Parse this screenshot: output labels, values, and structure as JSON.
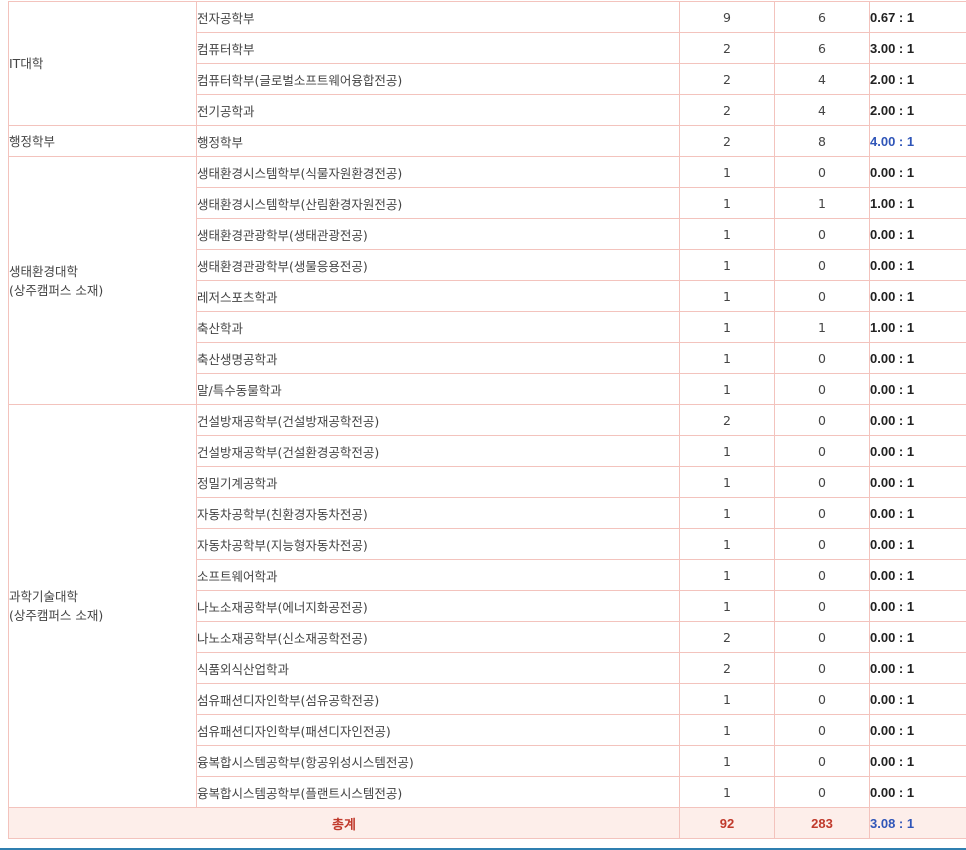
{
  "table": {
    "groups": [
      {
        "college_lines": [
          "IT대학"
        ],
        "rows": [
          {
            "dept": "전자공학부",
            "a": "9",
            "b": "6",
            "ratio": "0.67 : 1"
          },
          {
            "dept": "컴퓨터학부",
            "a": "2",
            "b": "6",
            "ratio": "3.00 : 1"
          },
          {
            "dept": "컴퓨터학부(글로벌소프트웨어융합전공)",
            "a": "2",
            "b": "4",
            "ratio": "2.00 : 1"
          },
          {
            "dept": "전기공학과",
            "a": "2",
            "b": "4",
            "ratio": "2.00 : 1"
          }
        ]
      },
      {
        "college_lines": [
          "행정학부"
        ],
        "rows": [
          {
            "dept": "행정학부",
            "a": "2",
            "b": "8",
            "ratio": "4.00 : 1",
            "highlight": true
          }
        ]
      },
      {
        "college_lines": [
          "생태환경대학",
          "(상주캠퍼스 소재)"
        ],
        "rows": [
          {
            "dept": "생태환경시스템학부(식물자원환경전공)",
            "a": "1",
            "b": "0",
            "ratio": "0.00 : 1"
          },
          {
            "dept": "생태환경시스템학부(산림환경자원전공)",
            "a": "1",
            "b": "1",
            "ratio": "1.00 : 1"
          },
          {
            "dept": "생태환경관광학부(생태관광전공)",
            "a": "1",
            "b": "0",
            "ratio": "0.00 : 1"
          },
          {
            "dept": "생태환경관광학부(생물응용전공)",
            "a": "1",
            "b": "0",
            "ratio": "0.00 : 1"
          },
          {
            "dept": "레저스포츠학과",
            "a": "1",
            "b": "0",
            "ratio": "0.00 : 1"
          },
          {
            "dept": "축산학과",
            "a": "1",
            "b": "1",
            "ratio": "1.00 : 1"
          },
          {
            "dept": "축산생명공학과",
            "a": "1",
            "b": "0",
            "ratio": "0.00 : 1"
          },
          {
            "dept": "말/특수동물학과",
            "a": "1",
            "b": "0",
            "ratio": "0.00 : 1"
          }
        ]
      },
      {
        "college_lines": [
          "과학기술대학",
          "(상주캠퍼스 소재)"
        ],
        "rows": [
          {
            "dept": "건설방재공학부(건설방재공학전공)",
            "a": "2",
            "b": "0",
            "ratio": "0.00 : 1"
          },
          {
            "dept": "건설방재공학부(건설환경공학전공)",
            "a": "1",
            "b": "0",
            "ratio": "0.00 : 1"
          },
          {
            "dept": "정밀기계공학과",
            "a": "1",
            "b": "0",
            "ratio": "0.00 : 1"
          },
          {
            "dept": "자동차공학부(친환경자동차전공)",
            "a": "1",
            "b": "0",
            "ratio": "0.00 : 1"
          },
          {
            "dept": "자동차공학부(지능형자동차전공)",
            "a": "1",
            "b": "0",
            "ratio": "0.00 : 1"
          },
          {
            "dept": "소프트웨어학과",
            "a": "1",
            "b": "0",
            "ratio": "0.00 : 1"
          },
          {
            "dept": "나노소재공학부(에너지화공전공)",
            "a": "1",
            "b": "0",
            "ratio": "0.00 : 1"
          },
          {
            "dept": "나노소재공학부(신소재공학전공)",
            "a": "2",
            "b": "0",
            "ratio": "0.00 : 1"
          },
          {
            "dept": "식품외식산업학과",
            "a": "2",
            "b": "0",
            "ratio": "0.00 : 1"
          },
          {
            "dept": "섬유패션디자인학부(섬유공학전공)",
            "a": "1",
            "b": "0",
            "ratio": "0.00 : 1"
          },
          {
            "dept": "섬유패션디자인학부(패션디자인전공)",
            "a": "1",
            "b": "0",
            "ratio": "0.00 : 1"
          },
          {
            "dept": "융복합시스템공학부(항공위성시스템전공)",
            "a": "1",
            "b": "0",
            "ratio": "0.00 : 1"
          },
          {
            "dept": "융복합시스템공학부(플랜트시스템전공)",
            "a": "1",
            "b": "0",
            "ratio": "0.00 : 1"
          }
        ]
      }
    ],
    "total": {
      "label": "총계",
      "a": "92",
      "b": "283",
      "ratio": "3.08 : 1"
    }
  },
  "colors": {
    "border": "#f3c3bd",
    "total_bg": "#fdeeea",
    "total_text": "#c0392b",
    "highlight_ratio": "#2f55b8",
    "bottom_line": "#2f7fb0"
  }
}
